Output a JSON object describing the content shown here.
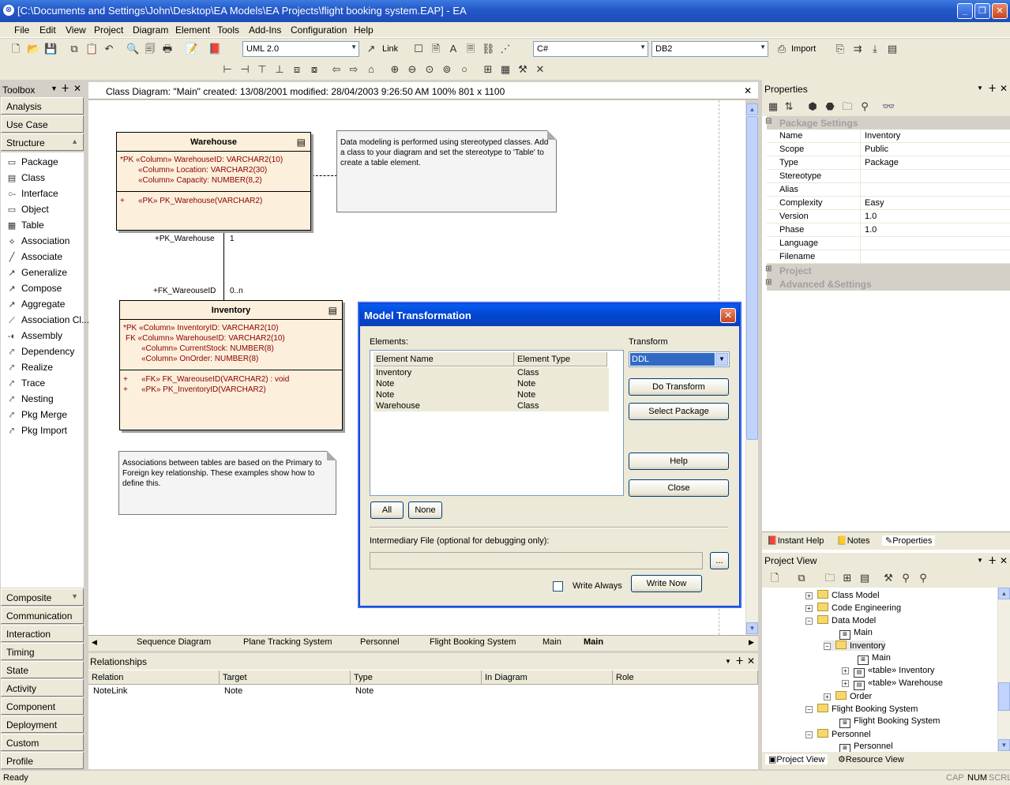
{
  "window": {
    "title": "[C:\\Documents and Settings\\John\\Desktop\\EA Models\\EA Projects\\flight booking system.EAP] - EA"
  },
  "menu": [
    "File",
    "Edit",
    "View",
    "Project",
    "Diagram",
    "Element",
    "Tools",
    "Add-Ins",
    "Configuration",
    "Help"
  ],
  "toolbar": {
    "uml_version": "UML 2.0",
    "link_label": "Link",
    "language": "C#",
    "database": "DB2",
    "import_label": "Import"
  },
  "toolbox": {
    "title": "Toolbox",
    "top_groups": [
      "Analysis",
      "Use Case",
      "Structure"
    ],
    "items": [
      {
        "icon": "package-icon",
        "label": "Package"
      },
      {
        "icon": "class-icon",
        "label": "Class"
      },
      {
        "icon": "interface-icon",
        "label": "Interface"
      },
      {
        "icon": "object-icon",
        "label": "Object"
      },
      {
        "icon": "table-icon",
        "label": "Table"
      },
      {
        "icon": "association-icon",
        "label": "Association"
      },
      {
        "icon": "associate-icon",
        "label": "Associate"
      },
      {
        "icon": "generalize-icon",
        "label": "Generalize"
      },
      {
        "icon": "compose-icon",
        "label": "Compose"
      },
      {
        "icon": "aggregate-icon",
        "label": "Aggregate"
      },
      {
        "icon": "association-class-icon",
        "label": "Association Cl..."
      },
      {
        "icon": "assembly-icon",
        "label": "Assembly"
      },
      {
        "icon": "dependency-icon",
        "label": "Dependency"
      },
      {
        "icon": "realize-icon",
        "label": "Realize"
      },
      {
        "icon": "trace-icon",
        "label": "Trace"
      },
      {
        "icon": "nesting-icon",
        "label": "Nesting"
      },
      {
        "icon": "pkg-merge-icon",
        "label": "Pkg Merge"
      },
      {
        "icon": "pkg-import-icon",
        "label": "Pkg Import"
      }
    ],
    "bottom_groups": [
      "Composite",
      "Communication",
      "Interaction",
      "Timing",
      "State",
      "Activity",
      "Component",
      "Deployment",
      "Custom",
      "Profile"
    ]
  },
  "diagram": {
    "header": "Class Diagram: \"Main\"   created: 13/08/2001  modified: 28/04/2003 9:26:50 AM   100%   801 x 1100",
    "warehouse": {
      "name": "Warehouse",
      "attrs": [
        "*PK «Column» WarehouseID:  VARCHAR2(10)",
        "«Column» Location:  VARCHAR2(30)",
        "«Column» Capacity:  NUMBER(8,2)"
      ],
      "ops": [
        "+",
        "«PK» PK_Warehouse(VARCHAR2)"
      ]
    },
    "inventory": {
      "name": "Inventory",
      "attrs": [
        "*PK «Column» InventoryID:  VARCHAR2(10)",
        "FK  «Column» WarehouseID:  VARCHAR2(10)",
        "«Column» CurrentStock:  NUMBER(8)",
        "«Column» OnOrder:  NUMBER(8)"
      ],
      "ops": [
        "«FK» FK_WareouseID(VARCHAR2) : void",
        "«PK» PK_InventoryID(VARCHAR2)"
      ]
    },
    "note1": "Data modeling is performed using stereotyped classes. Add a class to your diagram and set the stereotype to 'Table' to create a table element.",
    "note2": "Associations between tables are based on the Primary to Foreign key relationship. These examples show how to define this.",
    "assoc": {
      "role1": "+PK_Warehouse",
      "mult1": "1",
      "role2": "+FK_WareouseID",
      "mult2": "0..n"
    },
    "tabs": [
      "Sequence Diagram",
      "Plane Tracking System",
      "Personnel",
      "Flight Booking System",
      "Main",
      "Main"
    ]
  },
  "relationships": {
    "title": "Relationships",
    "columns": [
      "Relation",
      "Target",
      "Type",
      "In Diagram",
      "Role"
    ],
    "rows": [
      [
        "NoteLink",
        "Note",
        "Note",
        "",
        ""
      ]
    ]
  },
  "properties": {
    "title": "Properties",
    "group1": "Package Settings",
    "rows": [
      [
        "Name",
        "Inventory"
      ],
      [
        "Scope",
        "Public"
      ],
      [
        "Type",
        "Package"
      ],
      [
        "Stereotype",
        ""
      ],
      [
        "Alias",
        ""
      ],
      [
        "Complexity",
        "Easy"
      ],
      [
        "Version",
        "1.0"
      ],
      [
        "Phase",
        "1.0"
      ],
      [
        "Language",
        ""
      ],
      [
        "Filename",
        ""
      ]
    ],
    "group2": "Project",
    "group3": "Advanced &Settings",
    "tabs": [
      "Instant Help",
      "Notes",
      "Properties"
    ]
  },
  "project_view": {
    "title": "Project View",
    "nodes": [
      {
        "label": "Class Model",
        "type": "folder",
        "depth": 0,
        "exp": "+"
      },
      {
        "label": "Code Engineering",
        "type": "folder",
        "depth": 0,
        "exp": "+"
      },
      {
        "label": "Data Model",
        "type": "folder",
        "depth": 0,
        "exp": "-"
      },
      {
        "label": "Main",
        "type": "diagram",
        "depth": 1,
        "exp": ""
      },
      {
        "label": "Inventory",
        "type": "folder",
        "depth": 1,
        "exp": "-"
      },
      {
        "label": "Main",
        "type": "diagram",
        "depth": 2,
        "exp": ""
      },
      {
        "label": "«table» Inventory",
        "type": "table",
        "depth": 2,
        "exp": "+"
      },
      {
        "label": "«table» Warehouse",
        "type": "table",
        "depth": 2,
        "exp": "+"
      },
      {
        "label": "Order",
        "type": "folder",
        "depth": 1,
        "exp": "+"
      },
      {
        "label": "Flight Booking System",
        "type": "folder",
        "depth": 0,
        "exp": "-"
      },
      {
        "label": "Flight Booking System",
        "type": "diagram",
        "depth": 1,
        "exp": ""
      },
      {
        "label": "Personnel",
        "type": "folder",
        "depth": 0,
        "exp": "-"
      },
      {
        "label": "Personnel",
        "type": "diagram",
        "depth": 1,
        "exp": ""
      }
    ],
    "tabs": [
      "Project View",
      "Resource View"
    ]
  },
  "dialog": {
    "title": "Model Transformation",
    "elements_label": "Elements:",
    "transform_label": "Transform",
    "transform_value": "DDL",
    "columns": [
      "Element Name",
      "Element Type"
    ],
    "rows": [
      [
        "Inventory",
        "Class"
      ],
      [
        "Note",
        "Note"
      ],
      [
        "Note",
        "Note"
      ],
      [
        "Warehouse",
        "Class"
      ]
    ],
    "buttons": {
      "do_transform": "Do Transform",
      "select_package": "Select Package",
      "help": "Help",
      "close": "Close",
      "all": "All",
      "none": "None",
      "browse": "...",
      "write_now": "Write Now"
    },
    "intermediary_label": "Intermediary File (optional for debugging only):",
    "write_always": "Write Always"
  },
  "status": {
    "left": "Ready",
    "cap": "CAP",
    "num": "NUM",
    "scrl": "SCRL"
  }
}
